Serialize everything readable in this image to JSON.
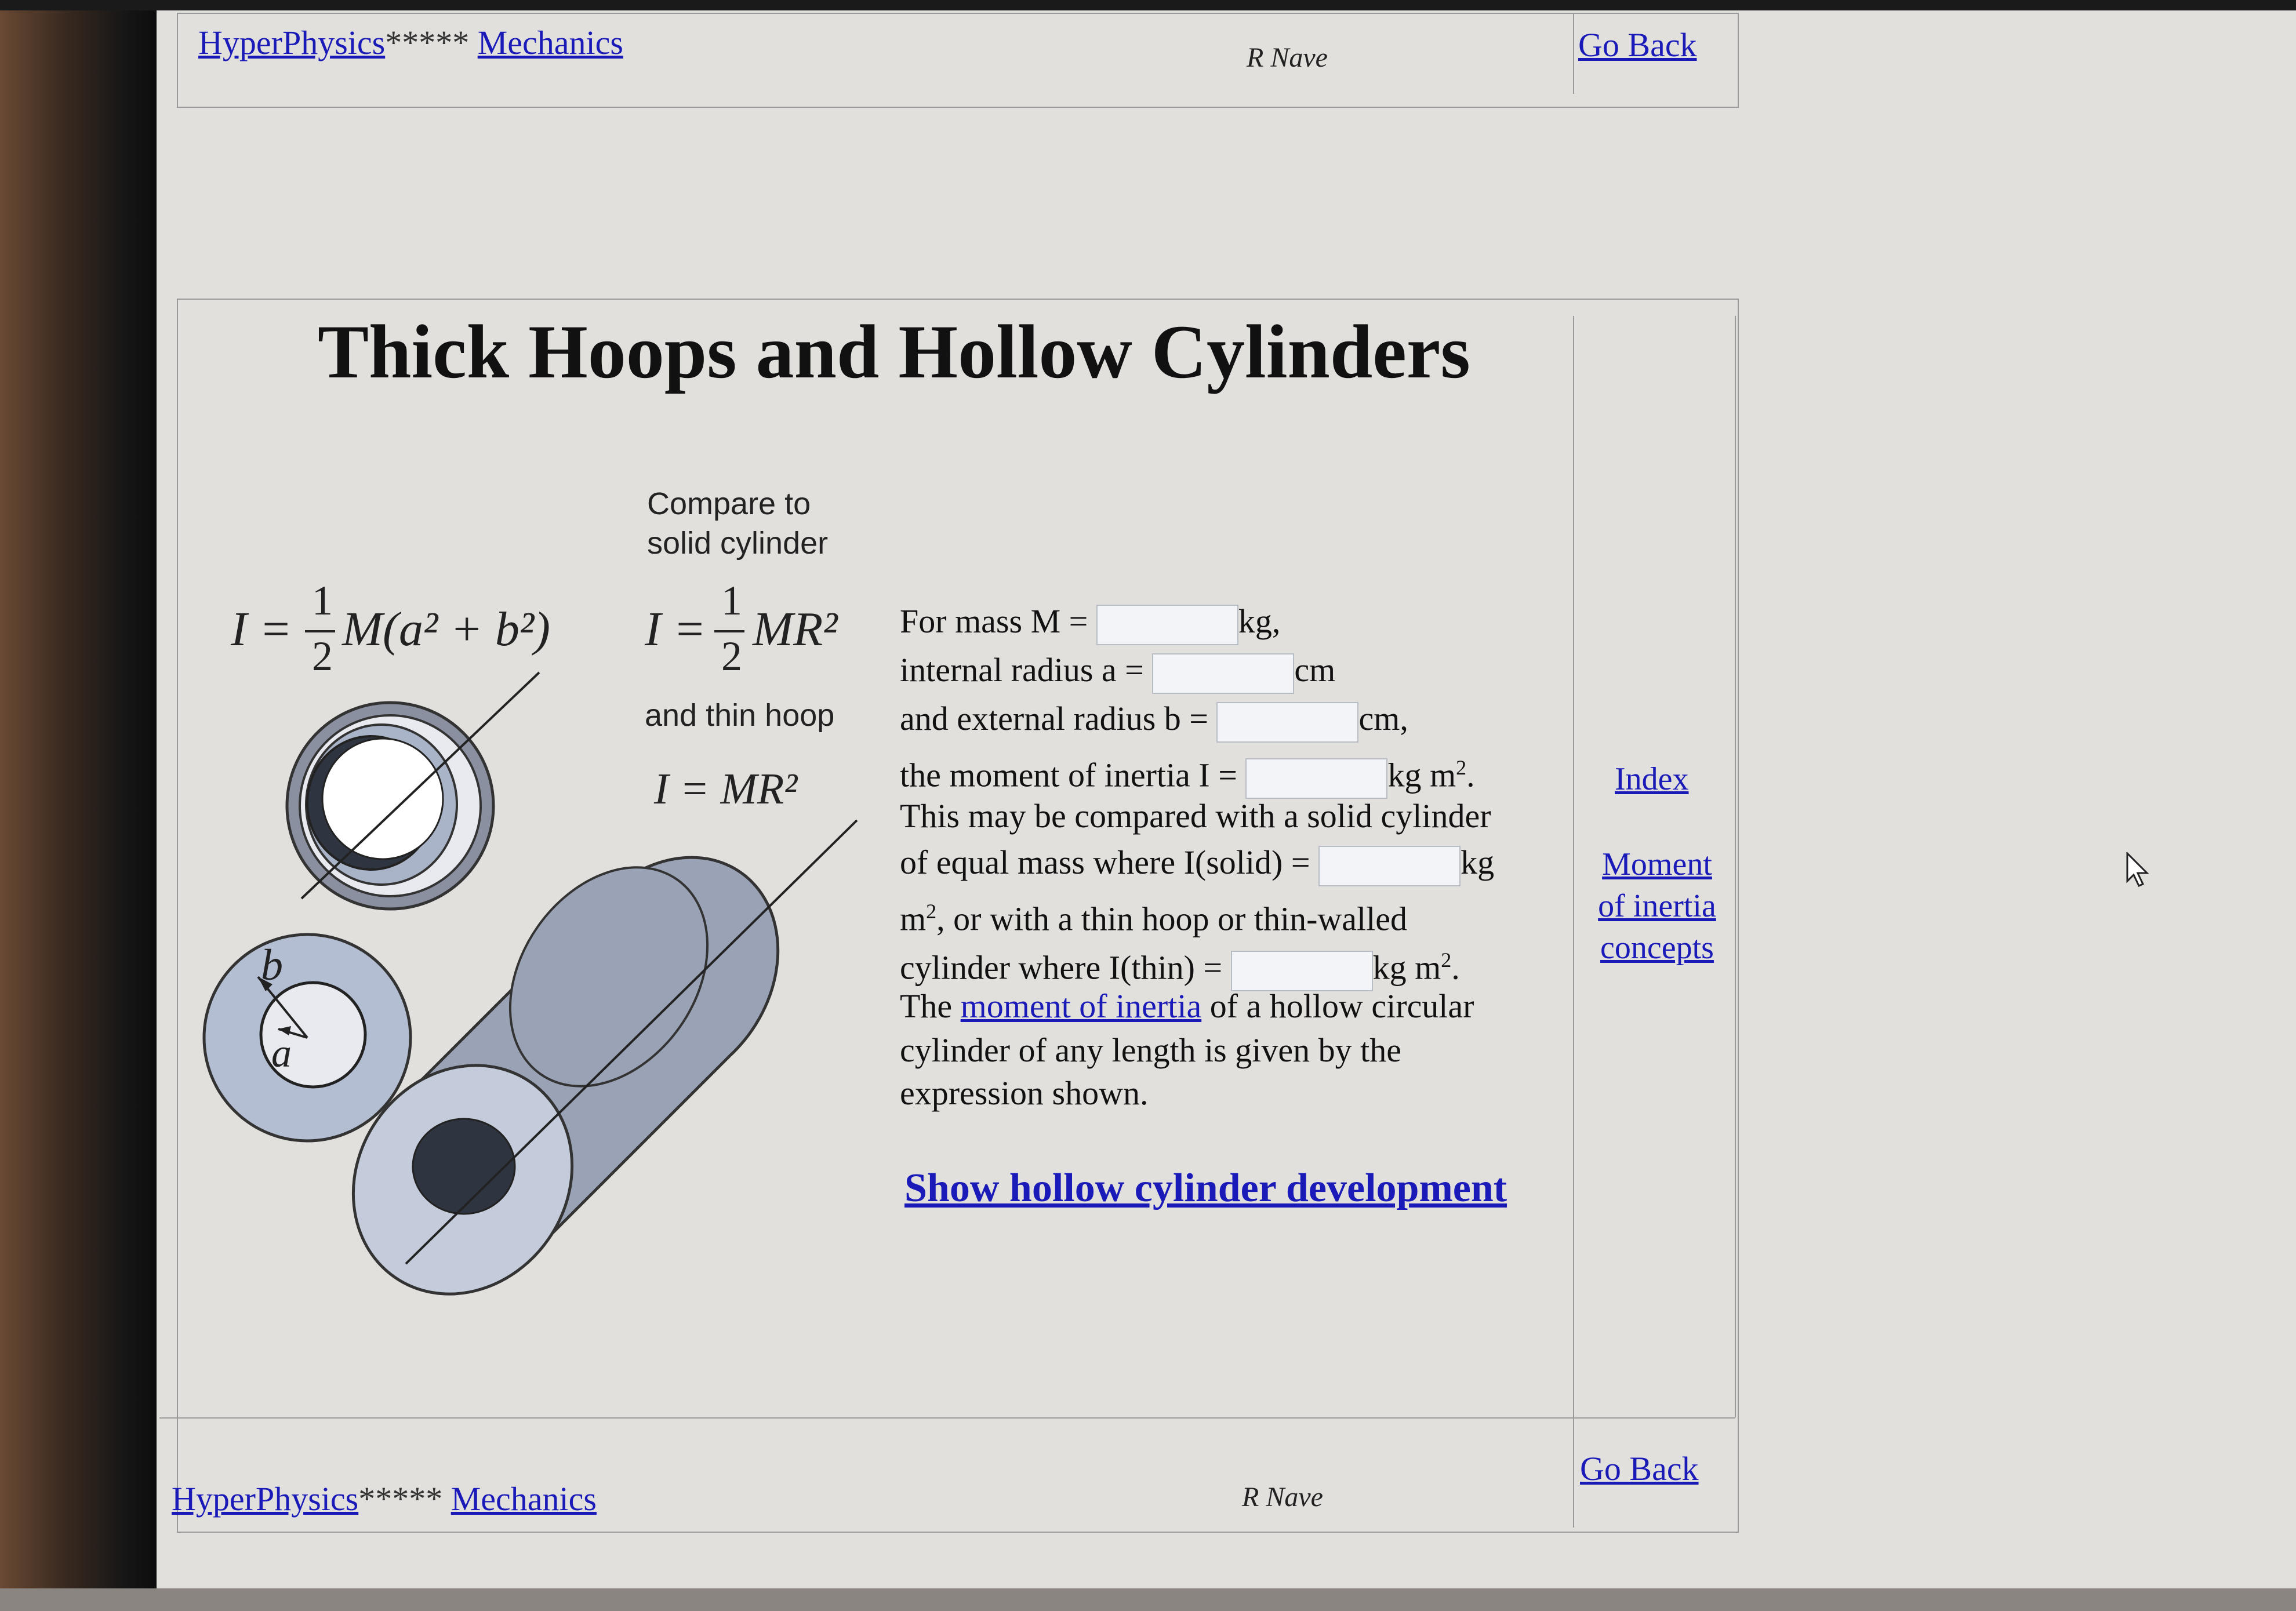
{
  "header": {
    "site_link": "HyperPhysics",
    "stars": "*****",
    "section_link": "Mechanics",
    "author": "R Nave",
    "go_back": "Go Back"
  },
  "title": "Thick Hoops and Hollow Cylinders",
  "diagram": {
    "compare_line1": "Compare to",
    "compare_line2": "solid cylinder",
    "and_thin_hoop": "and thin hoop",
    "eq_hollow_I": "I = ",
    "eq_hollow_frac_num": "1",
    "eq_hollow_frac_den": "2",
    "eq_hollow_rest": "M(a² + b²)",
    "eq_solid_I": "I = ",
    "eq_solid_frac_num": "1",
    "eq_solid_frac_den": "2",
    "eq_solid_rest": "MR²",
    "eq_hoop": "I = MR²",
    "label_b": "b",
    "label_a": "a"
  },
  "calculator": {
    "line1_pre": "For mass M = ",
    "line1_post": "kg,",
    "line2_pre": "internal radius a = ",
    "line2_post": "cm",
    "line3_pre": "and external radius b = ",
    "line3_post": "cm,",
    "line4_pre": "the moment of inertia I = ",
    "line4_post": "kg m",
    "line4_sup": "2",
    "line4_end": ".",
    "line5": "This may be compared with a solid cylinder",
    "line6_pre": "of equal mass where I(solid) = ",
    "line6_post": "kg",
    "line7_m": "m",
    "line7_sup": "2",
    "line7_rest": ", or with a thin hoop or thin-walled",
    "line8_pre": "cylinder where I(thin) = ",
    "line8_post": "kg m",
    "line8_sup": "2",
    "line8_end": ".",
    "line9_pre": "The ",
    "line9_link": "moment of inertia",
    "line9_post": " of a hollow circular",
    "line10": "cylinder of any length is given by the",
    "line11": "expression shown.",
    "fields": {
      "mass": "",
      "internal_radius": "",
      "external_radius": "",
      "moment": "",
      "solid_moment": "",
      "thin_moment": ""
    }
  },
  "show_development": "Show hollow cylinder development",
  "sidebar": {
    "index": "Index",
    "moi_line1": "Moment",
    "moi_line2": "of inertia",
    "moi_line3": "concepts"
  },
  "footer": {
    "site_link": "HyperPhysics",
    "stars": "*****",
    "section_link": "Mechanics",
    "author": "R Nave",
    "go_back": "Go Back"
  }
}
